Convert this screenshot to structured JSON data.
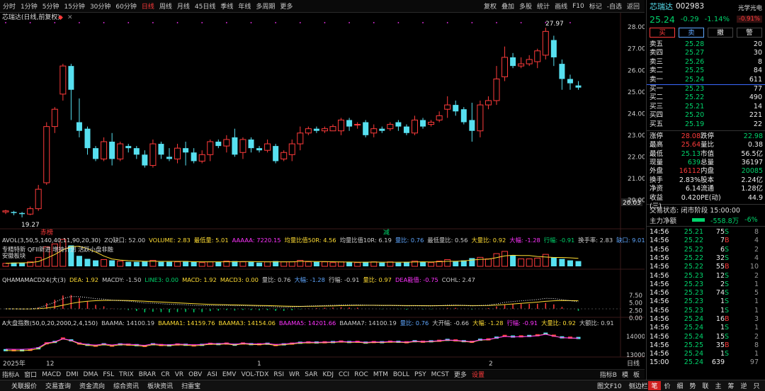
{
  "topbar": {
    "periods": [
      "分时",
      "1分钟",
      "5分钟",
      "15分钟",
      "30分钟",
      "60分钟",
      "日线",
      "周线",
      "月线",
      "45日线",
      "季线",
      "年线",
      "多周期",
      "更多"
    ],
    "active": "日线",
    "right": [
      "复权",
      "叠加",
      "多股",
      "统计",
      "画线",
      "F10",
      "标记",
      "-自选",
      "返回"
    ]
  },
  "main": {
    "title": "芯瑞达(日线,前复权)",
    "price_axis": [
      "28.00",
      "27.00",
      "26.00",
      "25.00",
      "24.00",
      "23.00",
      "22.00",
      "21.00",
      "20.00"
    ],
    "hi_label": "27.97",
    "lo_label": "19.27",
    "cur_price_tag": "20.03",
    "red_tag": "赤榜",
    "green_tag": "减"
  },
  "colors": {
    "up": "#ff3b3b",
    "down": "#57e0f0",
    "yellow": "#ffdd33",
    "magenta": "#ff33ff",
    "green": "#00d36b"
  },
  "chart_data": {
    "type": "candlestick",
    "y_range": [
      18.9,
      28.4
    ],
    "candles": [
      [
        19.45,
        19.5,
        19.35,
        19.55
      ],
      [
        19.45,
        19.4,
        19.3,
        19.5
      ],
      [
        19.4,
        19.35,
        19.2,
        19.45
      ],
      [
        19.35,
        19.6,
        19.3,
        19.7
      ],
      [
        19.6,
        20.5,
        19.5,
        20.7
      ],
      [
        20.8,
        23.4,
        20.7,
        23.6
      ],
      [
        23.4,
        24.2,
        23.1,
        24.3
      ],
      [
        24.9,
        26.2,
        24.6,
        26.3
      ],
      [
        26.2,
        25.1,
        23.7,
        26.3
      ],
      [
        23.6,
        23.2,
        22.9,
        24.7
      ],
      [
        23.3,
        22.4,
        22.1,
        23.4
      ],
      [
        22.4,
        21.9,
        21.8,
        22.5
      ],
      [
        21.9,
        22.7,
        21.8,
        22.9
      ],
      [
        22.7,
        21.9,
        21.6,
        23.1
      ],
      [
        21.9,
        22.6,
        21.8,
        22.7
      ],
      [
        22.5,
        22.4,
        22.2,
        22.6
      ],
      [
        22.4,
        22.1,
        21.9,
        22.5
      ],
      [
        22.1,
        21.6,
        21.5,
        22.3
      ],
      [
        21.6,
        22.6,
        21.5,
        22.8
      ],
      [
        22.6,
        22.1,
        21.9,
        22.7
      ],
      [
        22.0,
        21.9,
        21.8,
        22.4
      ],
      [
        21.9,
        22.4,
        21.7,
        22.6
      ],
      [
        22.4,
        22.2,
        21.6,
        22.7
      ],
      [
        22.2,
        21.8,
        21.7,
        22.4
      ],
      [
        21.8,
        22.1,
        21.7,
        22.3
      ],
      [
        22.1,
        22.7,
        21.8,
        22.8
      ],
      [
        22.7,
        22.5,
        22.4,
        22.8
      ],
      [
        22.5,
        22.8,
        22.2,
        23.0
      ],
      [
        22.9,
        22.1,
        22.0,
        23.3
      ],
      [
        22.2,
        22.8,
        21.9,
        22.9
      ],
      [
        22.8,
        22.4,
        22.2,
        22.9
      ],
      [
        22.4,
        22.3,
        22.2,
        22.5
      ],
      [
        22.3,
        22.6,
        22.2,
        22.8
      ],
      [
        22.5,
        21.8,
        21.7,
        22.6
      ],
      [
        21.9,
        22.2,
        21.8,
        22.3
      ],
      [
        22.1,
        22.6,
        21.8,
        22.8
      ],
      [
        22.6,
        23.1,
        22.3,
        23.4
      ],
      [
        23.1,
        23.3,
        23.0,
        23.4
      ],
      [
        23.3,
        23.2,
        23.1,
        23.4
      ],
      [
        23.2,
        23.3,
        23.1,
        23.4
      ],
      [
        23.2,
        23.4,
        23.2,
        23.5
      ],
      [
        23.2,
        23.7,
        23.0,
        23.8
      ],
      [
        23.7,
        23.4,
        23.2,
        23.8
      ],
      [
        23.5,
        23.5,
        23.3,
        23.6
      ],
      [
        23.6,
        23.0,
        22.9,
        23.7
      ],
      [
        23.1,
        23.3,
        22.9,
        23.5
      ],
      [
        23.3,
        23.2,
        23.1,
        23.4
      ],
      [
        23.3,
        23.5,
        23.2,
        23.6
      ],
      [
        23.6,
        23.4,
        23.2,
        23.7
      ],
      [
        23.4,
        23.1,
        23.0,
        23.5
      ],
      [
        23.1,
        23.7,
        23.0,
        23.9
      ],
      [
        23.7,
        23.4,
        23.3,
        23.8
      ],
      [
        23.5,
        23.6,
        23.4,
        23.7
      ],
      [
        23.7,
        23.9,
        23.6,
        24.1
      ],
      [
        24.2,
        24.4,
        23.8,
        24.8
      ],
      [
        24.4,
        24.1,
        23.9,
        24.6
      ],
      [
        24.2,
        23.6,
        23.5,
        24.3
      ],
      [
        23.7,
        23.2,
        22.7,
        24.5
      ],
      [
        23.2,
        24.4,
        22.9,
        24.6
      ],
      [
        24.4,
        24.6,
        24.2,
        24.8
      ],
      [
        24.6,
        25.6,
        24.4,
        26.2
      ],
      [
        25.7,
        26.6,
        25.5,
        27.1
      ],
      [
        26.6,
        26.2,
        26.1,
        26.8
      ],
      [
        26.2,
        26.3,
        26.1,
        26.6
      ],
      [
        26.3,
        26.5,
        26.2,
        26.7
      ],
      [
        26.4,
        26.9,
        26.1,
        27.0
      ],
      [
        26.7,
        27.8,
        26.5,
        27.97
      ],
      [
        27.4,
        26.6,
        26.2,
        27.6
      ],
      [
        26.3,
        25.6,
        25.1,
        26.5
      ],
      [
        25.6,
        25.4,
        25.1,
        25.8
      ],
      [
        25.3,
        25.2,
        25.1,
        25.5
      ]
    ]
  },
  "ind1": {
    "title": "AVOL(3,50,5,140,40,11,90,20,30)",
    "items": [
      {
        "t": "ZQ缺口: 52.00",
        "c": "#cccccc"
      },
      {
        "t": "VOLUME: 2.83",
        "c": "#ffdd33"
      },
      {
        "t": "最低量: 5.01",
        "c": "#ffdd33"
      },
      {
        "t": "AAAAA: 7220.15",
        "c": "#ff33ff"
      },
      {
        "t": "均量比值50R: 4.56",
        "c": "#ffdd33"
      },
      {
        "t": "均量比值10R: 6.19",
        "c": "#cccccc"
      },
      {
        "t": "量比: 0.76",
        "c": "#5fa7ff"
      },
      {
        "t": "最低量比: 0.56",
        "c": "#cccccc"
      },
      {
        "t": "大量比: 0.92",
        "c": "#ffdd33"
      },
      {
        "t": "大幅: -1.28",
        "c": "#ff33ff"
      },
      {
        "t": "行幅: -0.91",
        "c": "#00d36b"
      },
      {
        "t": "换手率: 2.83",
        "c": "#cccccc"
      },
      {
        "t": "缺口: 9.01",
        "c": "#5fa7ff"
      },
      {
        "t": "XR",
        "c": "#cccccc"
      }
    ],
    "note1": "专精特新 QFII新进 增持计划 活跃小盘非融",
    "note2": "安徽板块",
    "vols": [
      4,
      5,
      5,
      6,
      12,
      26,
      30,
      36,
      28,
      14,
      10,
      8,
      9,
      8,
      7,
      6,
      6,
      7,
      8,
      6,
      6,
      6,
      7,
      6,
      5,
      6,
      6,
      7,
      7,
      6,
      6,
      5,
      6,
      7,
      6,
      6,
      8,
      6,
      6,
      6,
      5,
      6,
      6,
      5,
      6,
      6,
      5,
      6,
      5,
      6,
      7,
      6,
      5,
      7,
      9,
      7,
      8,
      11,
      12,
      10,
      17,
      20,
      15,
      10,
      10,
      11,
      16,
      12,
      10,
      8,
      7
    ]
  },
  "ind2": {
    "title": "QHAMAMACD24(大(3)",
    "items": [
      {
        "t": "DEA: 1.92",
        "c": "#ffdd33"
      },
      {
        "t": "MACDY: -1.50",
        "c": "#cccccc"
      },
      {
        "t": "LINE3: 0.00",
        "c": "#00d36b"
      },
      {
        "t": "MACD: 1.92",
        "c": "#ffdd33"
      },
      {
        "t": "MACD3: 0.00",
        "c": "#ffdd33"
      },
      {
        "t": "量比: 0.76",
        "c": "#cccccc"
      },
      {
        "t": "大幅: -1.28",
        "c": "#5fa7ff"
      },
      {
        "t": "行幅: -0.91",
        "c": "#cccccc"
      },
      {
        "t": "量比: 0.97",
        "c": "#ffdd33"
      },
      {
        "t": "DEA能值: -0.75",
        "c": "#ff33ff"
      },
      {
        "t": "COHL: 2.47",
        "c": "#cccccc"
      }
    ],
    "axis": [
      "7.50",
      "5.00",
      "2.50",
      "0.00"
    ]
  },
  "ind3": {
    "title": "A大盘指数(50,0,20,2000,2,4,150)",
    "items": [
      {
        "t": "BAAMA: 14100.19",
        "c": "#cccccc"
      },
      {
        "t": "BAAMA1: 14159.76",
        "c": "#ffdd33"
      },
      {
        "t": "BAAMA3: 14154.06",
        "c": "#ffdd33"
      },
      {
        "t": "BAAMA5: 14201.66",
        "c": "#ff33ff"
      },
      {
        "t": "BAAMA7: 14100.19",
        "c": "#cccccc"
      },
      {
        "t": "量比: 0.76",
        "c": "#5fa7ff"
      },
      {
        "t": "大开幅: -0.66",
        "c": "#cccccc"
      },
      {
        "t": "大幅: -1.28",
        "c": "#ffdd33"
      },
      {
        "t": "行幅: -0.91",
        "c": "#ff33ff"
      },
      {
        "t": "大量比: 0.92",
        "c": "#ffdd33"
      },
      {
        "t": "大额比: 0.91",
        "c": "#cccccc"
      }
    ],
    "axis": [
      "14000",
      "13000"
    ]
  },
  "xaxis": {
    "year": "2025年",
    "m12": "12",
    "m1": "1",
    "m2": "2",
    "period_btn": "日线"
  },
  "bottombar": {
    "tabs": [
      "指标A",
      "窗口",
      "MACD",
      "DMI",
      "DMA",
      "FSL",
      "TRIX",
      "BRAR",
      "CR",
      "VR",
      "OBV",
      "ASI",
      "EMV",
      "VOL-TDX",
      "RSI",
      "WR",
      "SAR",
      "KDJ",
      "CCI",
      "ROC",
      "MTM",
      "BOLL",
      "PSY",
      "MCST",
      "更多",
      "设置"
    ],
    "right": [
      "指标B",
      "模",
      "板"
    ]
  },
  "footer": {
    "left": [
      "关联报价",
      "交易查询",
      "资金流向",
      "综合资讯",
      "板块资讯",
      "扫雷宝"
    ],
    "right": [
      "图文F10",
      "侧边栏"
    ],
    "icons": [
      "笔",
      "价",
      "细",
      "势",
      "联",
      "主",
      "筹",
      "逆",
      "只"
    ]
  },
  "quote": {
    "name": "芯瑞达",
    "code": "002983",
    "sector": "光学光电",
    "sector_chg": "-0.91%",
    "price": "25.24",
    "chg": "-0.29",
    "pct": "-1.14%",
    "buttons": [
      "买",
      "卖",
      "撤",
      "警"
    ],
    "asks": [
      [
        "卖五",
        "25.28",
        "20"
      ],
      [
        "卖四",
        "25.27",
        "30"
      ],
      [
        "卖三",
        "25.26",
        "8"
      ],
      [
        "卖二",
        "25.25",
        "84"
      ],
      [
        "卖一",
        "25.24",
        "611"
      ]
    ],
    "bids": [
      [
        "买一",
        "25.23",
        "77"
      ],
      [
        "买二",
        "25.22",
        "490"
      ],
      [
        "买三",
        "25.21",
        "14"
      ],
      [
        "买四",
        "25.20",
        "221"
      ],
      [
        "买五",
        "25.19",
        "22"
      ]
    ],
    "stats": [
      [
        "涨停",
        "28.08",
        "跌停",
        "22.98"
      ],
      [
        "最高",
        "25.64",
        "量比",
        "0.38"
      ],
      [
        "最低",
        "25.13",
        "市值",
        "56.5亿"
      ],
      [
        "现量",
        "639",
        "总量",
        "36197"
      ],
      [
        "外盘",
        "16112",
        "内盘",
        "20085"
      ],
      [
        "换手",
        "2.83%",
        "股本",
        "2.24亿"
      ],
      [
        "净资",
        "6.14",
        "流通",
        "1.28亿"
      ],
      [
        "收益(三)",
        "0.420",
        "PE(动)",
        "44.9"
      ]
    ],
    "trade_status": "交易状态: 闭市阶段 15:00:00",
    "main_flow_label": "主力净额",
    "main_flow": "-558.8万",
    "main_pct": "-6%",
    "ticks": [
      [
        "14:56",
        "25.21",
        "75",
        "S",
        "8"
      ],
      [
        "14:56",
        "25.22",
        "7",
        "B",
        "4"
      ],
      [
        "14:56",
        "25.22",
        "6",
        "S",
        "2"
      ],
      [
        "14:56",
        "25.22",
        "32",
        "S",
        "4"
      ],
      [
        "14:56",
        "25.22",
        "55",
        "B",
        "10"
      ],
      [
        "14:56",
        "25.23",
        "12",
        "S",
        "2"
      ],
      [
        "14:56",
        "25.23",
        "2",
        "S",
        "1"
      ],
      [
        "14:56",
        "25.23",
        "74",
        "S",
        "5"
      ],
      [
        "14:56",
        "25.23",
        "1",
        "S",
        "1"
      ],
      [
        "14:56",
        "25.23",
        "1",
        "S",
        "1"
      ],
      [
        "14:56",
        "25.24",
        "16",
        "B",
        "3"
      ],
      [
        "14:56",
        "25.24",
        "1",
        "S",
        "1"
      ],
      [
        "14:56",
        "25.24",
        "15",
        "S",
        "2"
      ],
      [
        "14:56",
        "25.25",
        "35",
        "B",
        "8"
      ],
      [
        "14:56",
        "25.24",
        "1",
        "S",
        "1"
      ],
      [
        "15:00",
        "25.24",
        "639",
        "",
        "97"
      ]
    ]
  }
}
